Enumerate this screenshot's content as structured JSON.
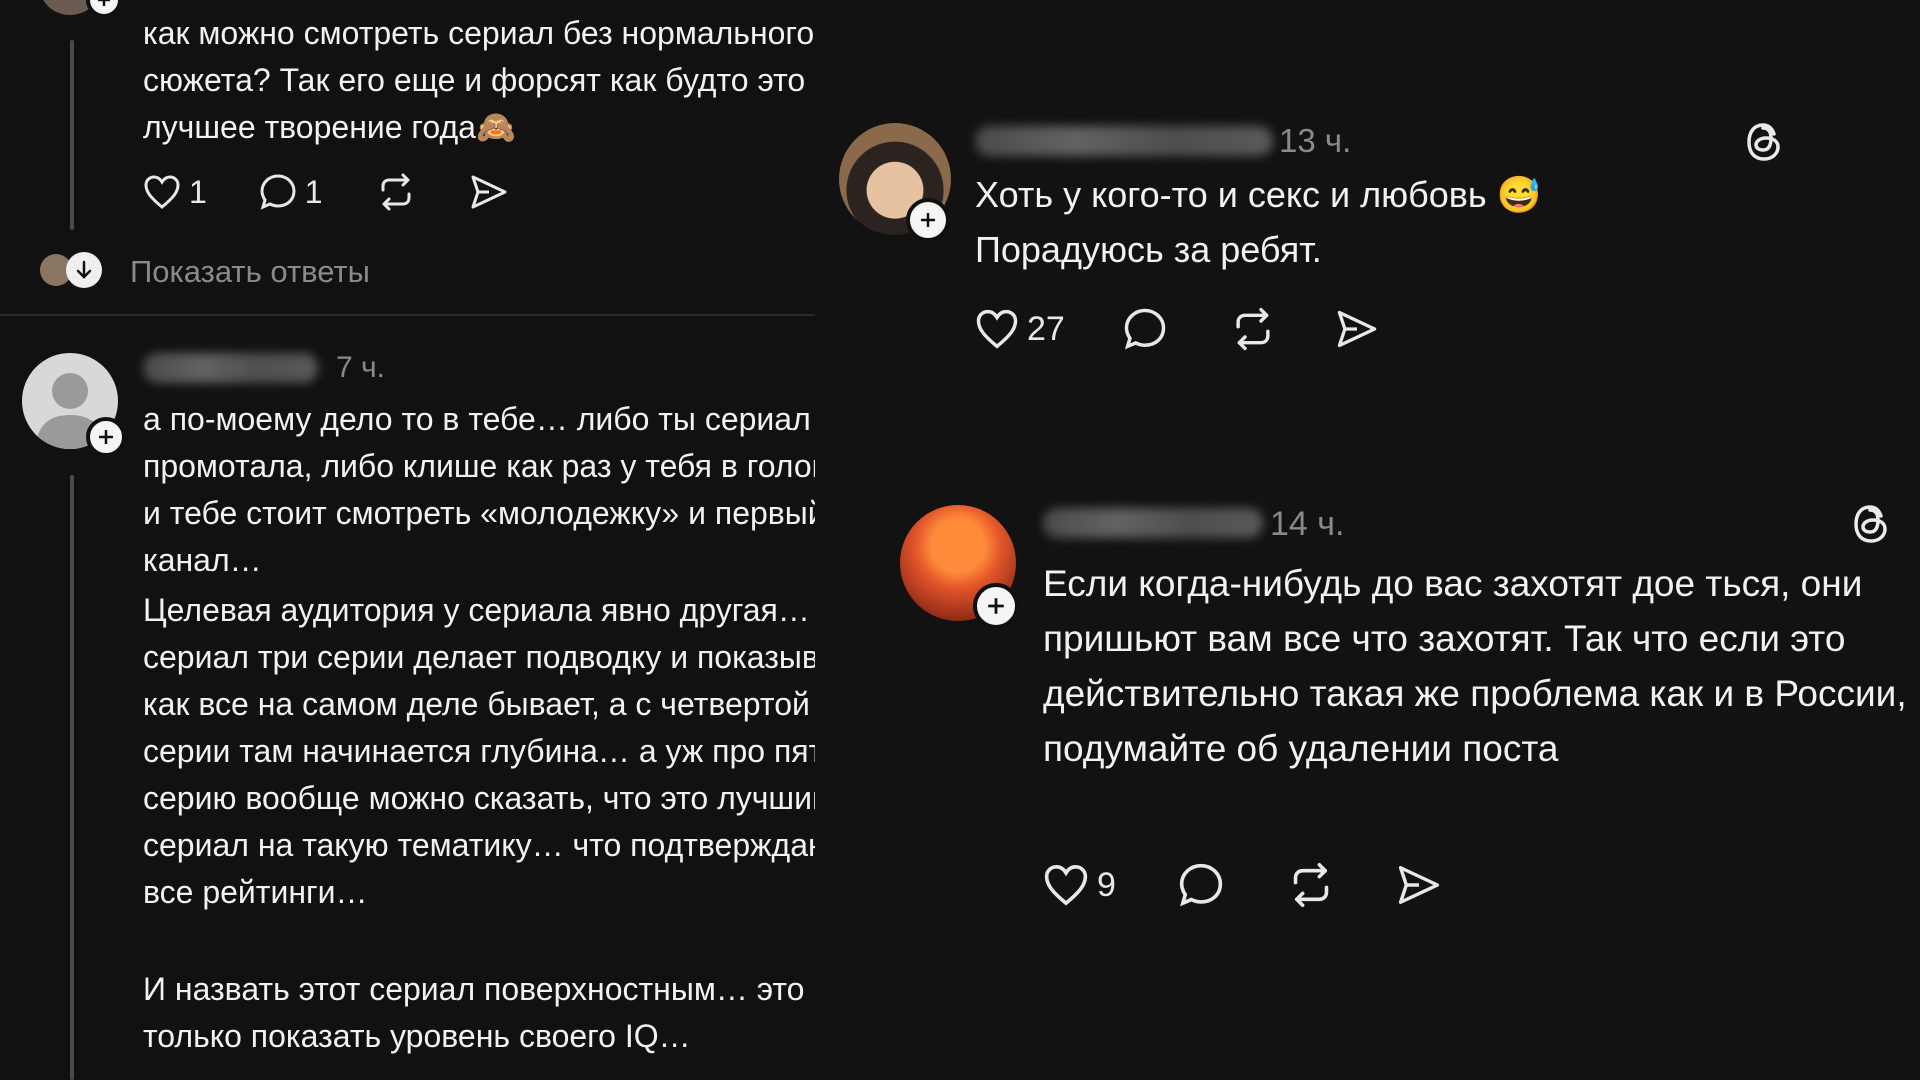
{
  "left": {
    "top_comment": {
      "text": "как можно смотреть сериал без нормального сюжета? Так его еще и форсят как будто это лучшее творение года🙈",
      "like_count": "1",
      "reply_count": "1",
      "icons": [
        "heart-icon",
        "comment-icon",
        "repost-icon",
        "share-icon"
      ]
    },
    "show_replies": "Показать ответы",
    "reply": {
      "time": "7 ч.",
      "paragraphs": [
        "а по-моему дело то в тебе… либо ты сериал промотала, либо клише как раз у тебя  в голове и тебе стоит смотреть «молодежку» и первый канал…",
        "Целевая аудитория у сериала явно другая… сериал три  серии делает подводку и показывает как все на самом деле бывает, а с четвертой  серии там начинается глубина… а уж про пятую серию вообще можно сказать, что это  лучший сериал на такую тематику… что подтверждают все рейтинги…",
        "И назвать этот сериал поверхностным… это только показать уровень своего IQ…"
      ]
    }
  },
  "right": {
    "post1": {
      "time": "13 ч.",
      "line1": "Хоть у кого-то и секс и любовь 😅",
      "line2": "Порадуюсь за ребят.",
      "like_count": "27"
    },
    "post2": {
      "time": "14 ч.",
      "text": "Если когда-нибудь до вас захотят дое  ться, они пришьют вам все что захотят. Так что если это действительно такая же проблема как и в России, подумайте об удалении поста",
      "like_count": "9"
    }
  },
  "colors": {
    "background": "#0f0f10",
    "text": "#f2f2f2",
    "muted": "#8a8a8c"
  }
}
